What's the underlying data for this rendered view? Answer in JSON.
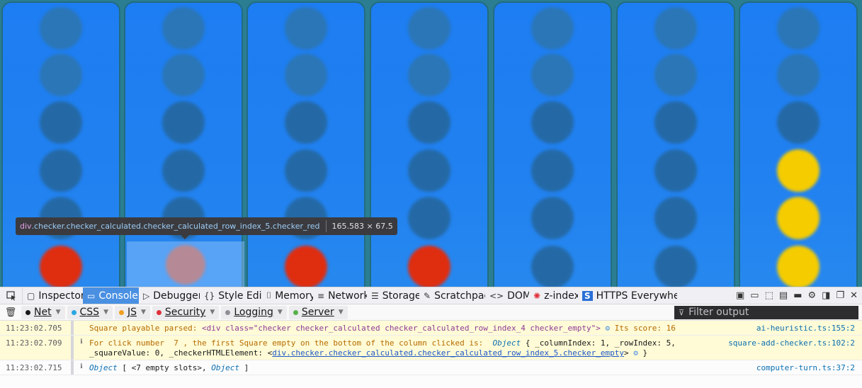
{
  "board": {
    "columns": [
      {
        "checkers": [
          "empty-light",
          "empty-light",
          "empty",
          "empty",
          "empty",
          "red"
        ]
      },
      {
        "checkers": [
          "empty-light",
          "empty-light",
          "empty",
          "empty",
          "empty",
          "highlight"
        ]
      },
      {
        "checkers": [
          "empty-light",
          "empty-light",
          "empty",
          "empty",
          "empty",
          "red"
        ]
      },
      {
        "checkers": [
          "empty-light",
          "empty-light",
          "empty",
          "empty",
          "empty",
          "red"
        ]
      },
      {
        "checkers": [
          "empty-light",
          "empty-light",
          "empty",
          "empty",
          "empty",
          "empty"
        ]
      },
      {
        "checkers": [
          "empty-light",
          "empty-light",
          "empty",
          "empty",
          "empty",
          "empty"
        ]
      },
      {
        "checkers": [
          "empty-light",
          "empty-light",
          "empty",
          "yellow",
          "yellow",
          "yellow"
        ]
      }
    ],
    "colors": {
      "red": "#df2d10",
      "yellow": "#f5cc00",
      "board_blue": "#1d7df2"
    }
  },
  "tooltip": {
    "tag": "div",
    "classes": ".checker.checker_calculated.checker_calculated_row_index_5.checker_red",
    "size": "165.583 × 67.5"
  },
  "devtools": {
    "tabs": [
      {
        "icon": "inspector-icon",
        "glyph": "▢",
        "label": "Inspector"
      },
      {
        "icon": "console-icon",
        "glyph": "▭",
        "label": "Console"
      },
      {
        "icon": "debugger-icon",
        "glyph": "▷",
        "label": "Debugger"
      },
      {
        "icon": "style-editor-icon",
        "glyph": "{}",
        "label": "Style Editor"
      },
      {
        "icon": "memory-icon",
        "glyph": "⌷",
        "label": "Memory"
      },
      {
        "icon": "network-icon",
        "glyph": "≡",
        "label": "Network"
      },
      {
        "icon": "storage-icon",
        "glyph": "☰",
        "label": "Storage"
      },
      {
        "icon": "scratchpad-icon",
        "glyph": "✎",
        "label": "Scratchpad"
      },
      {
        "icon": "dom-icon",
        "glyph": "<>",
        "label": "DOM"
      },
      {
        "icon": "z-index-icon",
        "glyph": "✺",
        "label": "z-index"
      },
      {
        "icon": "https-everywhere-icon",
        "glyph": "S",
        "label": "HTTPS Everywhere"
      }
    ],
    "filters": {
      "net": "Net",
      "css": "CSS",
      "js": "JS",
      "security": "Security",
      "logging": "Logging",
      "server": "Server",
      "filter_placeholder": "Filter output"
    },
    "filter_colors": {
      "net": "#18181a",
      "css": "#2aa6e4",
      "js": "#f29e1f",
      "security": "#e0303a",
      "logging": "#8f8f95",
      "server": "#59b14b"
    },
    "messages": [
      {
        "time": "11:23:02.705",
        "text_prefix": "Square playable parsed: ",
        "html": "<div class=\"checker checker_calculated checker_calculated_row_index_4 checker_empty\">",
        "text_suffix": " Its score: 16",
        "location": "ai-heuristic.ts:155:2"
      },
      {
        "time": "11:23:02.709",
        "line1": "For click number  7 , the first Square empty on the bottom of the column clicked is:  ",
        "object_label": "Object",
        "object_body": " { _columnIndex: 1, _rowIndex: 5,",
        "line2_prefix": "_squareValue: 0, _checkerHTMLElement: <",
        "line2_link": "div.checker.checker_calculated.checker_calculated_row_index_5.checker_empty",
        "line2_suffix": "> ",
        "line2_end": " }",
        "location": "square-add-checker.ts:102:2"
      },
      {
        "time": "11:23:02.715",
        "object_label": "Object",
        "body": " [ <7 empty slots>, ",
        "object_label_2": "Object",
        "end": " ]",
        "location": "computer-turn.ts:37:2"
      }
    ]
  }
}
